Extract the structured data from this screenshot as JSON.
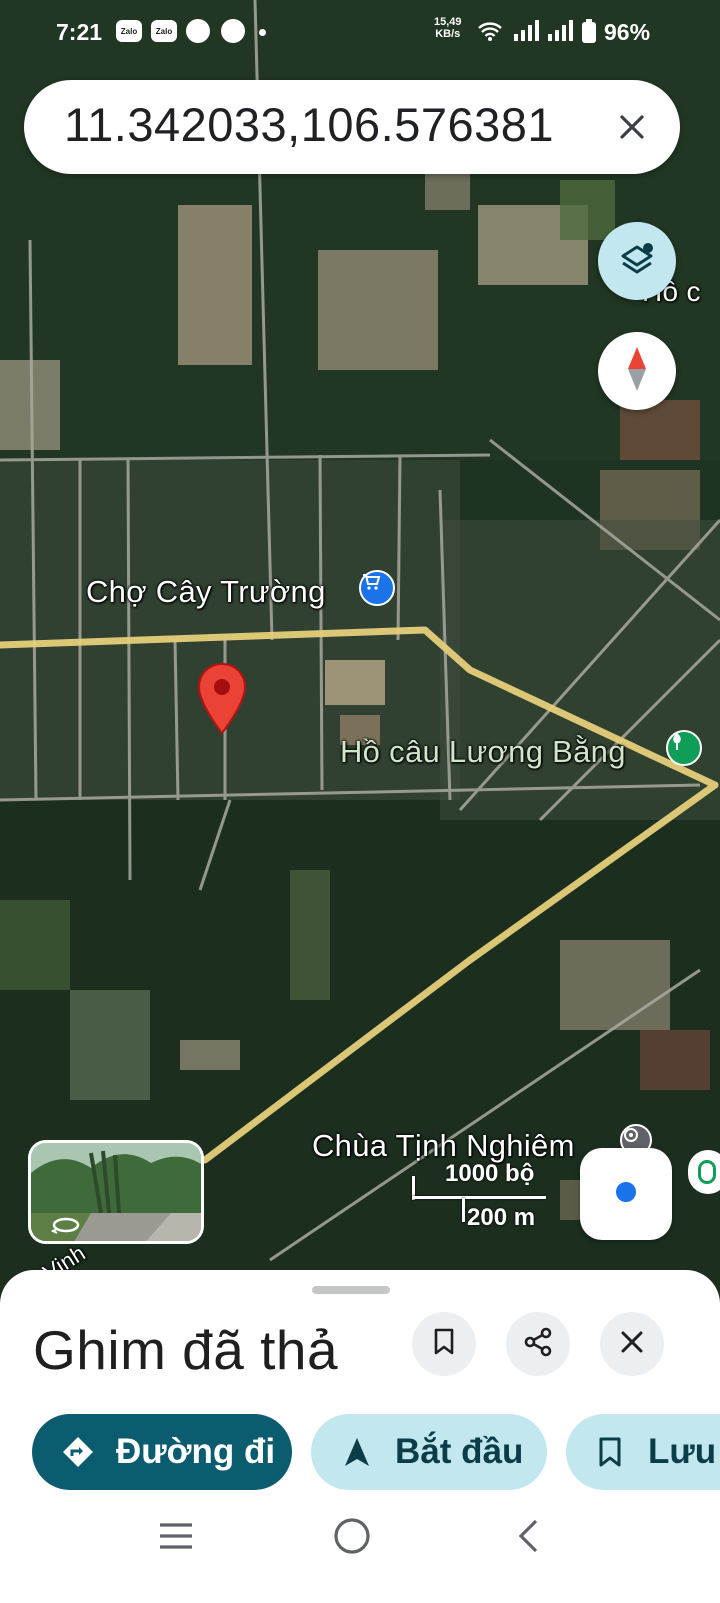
{
  "status_bar": {
    "time": "7:21",
    "app_icons": [
      "Zalo",
      "Zalo"
    ],
    "net_speed_value": "15,49",
    "net_speed_unit": "KB/s",
    "battery": "96%"
  },
  "search": {
    "query": "11.342033,106.576381",
    "clear_icon": "close-icon"
  },
  "map": {
    "labels": {
      "market": "Chợ Cây Trường",
      "fishing_pond": "Hồ câu Lương Bằng",
      "pagoda": "Chùa Tịnh Nghiêm",
      "top_right_partial": "Hồ c",
      "road_partial": "Vinh"
    },
    "scale": {
      "imperial": "1000 bộ",
      "metric": "200 m"
    },
    "colors": {
      "road": "#e6cf7a",
      "pin": "#ea4335",
      "shopping_poi": "#1a73e8",
      "park_poi": "#0f9d58"
    }
  },
  "sheet": {
    "title": "Ghim đã thả",
    "directions_label": "Đường đi",
    "start_label": "Bắt đầu",
    "save_label": "Lưu"
  }
}
